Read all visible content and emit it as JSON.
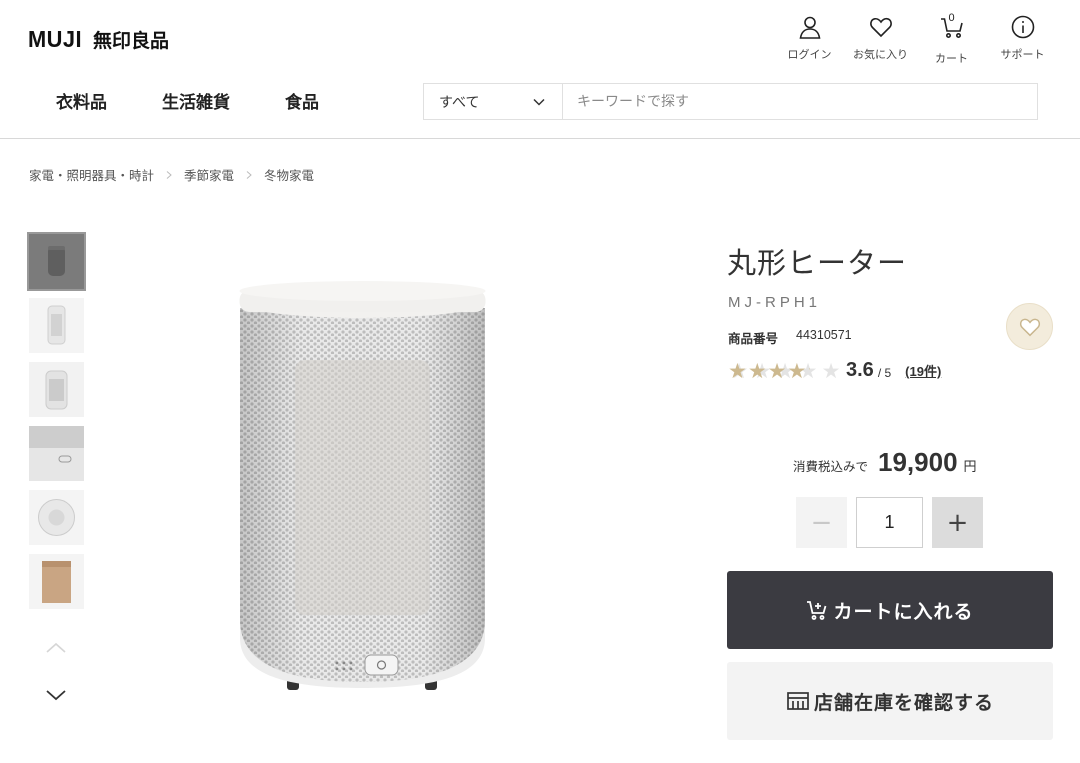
{
  "header": {
    "logo_latin": "MUJI",
    "logo_jp": "無印良品",
    "util": [
      {
        "label": "ログイン",
        "icon": "user-icon"
      },
      {
        "label": "お気に入り",
        "icon": "heart-icon"
      },
      {
        "label": "カート",
        "icon": "cart-icon",
        "count": "0"
      },
      {
        "label": "サポート",
        "icon": "info-icon"
      }
    ],
    "categories": [
      "衣料品",
      "生活雑貨",
      "食品"
    ],
    "search": {
      "select_value": "すべて",
      "placeholder": "キーワードで探す",
      "value": ""
    }
  },
  "breadcrumb": [
    "家電・照明器具・時計",
    "季節家電",
    "冬物家電"
  ],
  "thumbnails": [
    {
      "name": "heater-front-gray"
    },
    {
      "name": "heater-front-small"
    },
    {
      "name": "heater-angle"
    },
    {
      "name": "heater-closeup-controls"
    },
    {
      "name": "heater-top-view"
    },
    {
      "name": "heater-package-box"
    }
  ],
  "product": {
    "title": "丸形ヒーター",
    "model": "MJ-RPH1",
    "id_label": "商品番号",
    "id_value": "44310571",
    "rating": 3.6,
    "rating_text": "3.6",
    "rating_max": "/ 5",
    "reviews": "(19件)",
    "price_label": "消費税込みで",
    "price": "19,900",
    "price_unit": "円",
    "quantity": "1",
    "minus_label": "−",
    "plus_label": "+",
    "cart_button": "カートに入れる",
    "store_button": "店舗在庫を確認する"
  },
  "colors": {
    "cart_button_bg": "#3b3b41",
    "star_color": "#cdb98f",
    "fav_bg": "#f3ecdc"
  }
}
